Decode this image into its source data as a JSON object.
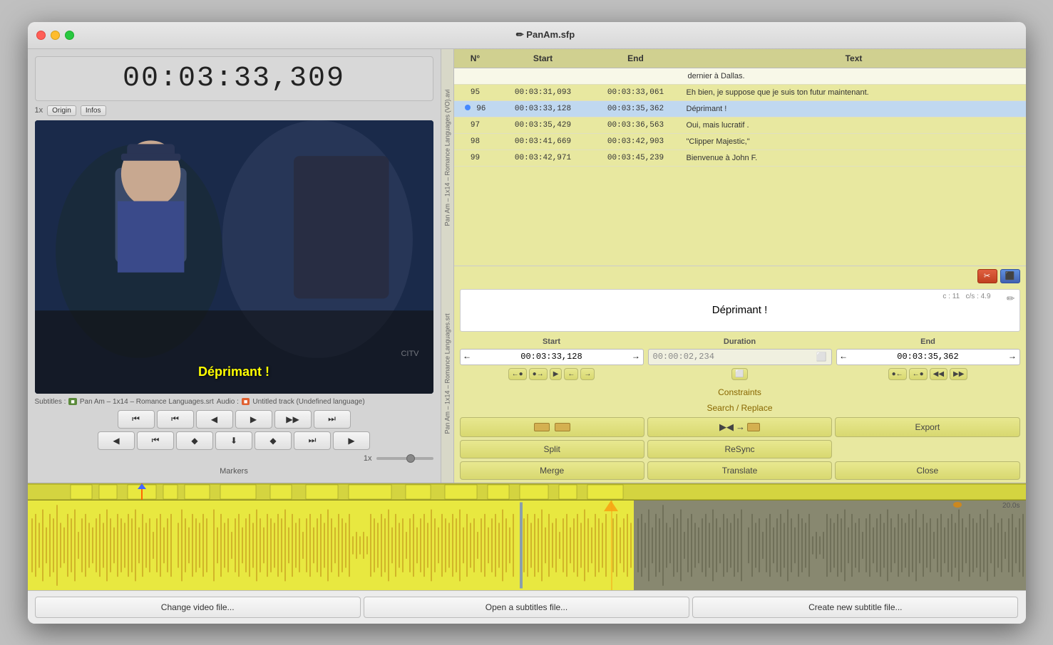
{
  "window": {
    "title": "✏ PanAm.sfp",
    "traffic_lights": [
      "close",
      "minimize",
      "fullscreen"
    ]
  },
  "timecode": "00:03:33,309",
  "video": {
    "subtitle_text": "Déprimant !",
    "watermark": "CITV",
    "magnification": "1x",
    "origin_btn": "Origin",
    "infos_btn": "Infos"
  },
  "subtitles_file": "Pan Am – 1x14 – Romance Languages (VO).avi",
  "subtitle_track": "Pan Am – 1x14 – Romance Languages.srt",
  "audio_track": "Untitled track (Undefined language)",
  "transport": {
    "row1": [
      "⏮",
      "⏮⏮",
      "◀",
      "▶",
      "▶▶",
      "⏭"
    ],
    "row2": [
      "◀",
      "◀◀",
      "◆",
      "⬇",
      "◆",
      "▶▶",
      "▶"
    ]
  },
  "speed": "1x",
  "markers_label": "Markers",
  "table": {
    "headers": [
      "N°",
      "Start",
      "End",
      "Text"
    ],
    "pre_row": {
      "text": "dernier à Dallas."
    },
    "rows": [
      {
        "num": "95",
        "start": "00:03:31,093",
        "end": "00:03:33,061",
        "text": "Eh bien, je suppose que je suis ton futur maintenant.",
        "selected": false
      },
      {
        "num": "96",
        "start": "00:03:33,128",
        "end": "00:03:35,362",
        "text": "Déprimant !",
        "selected": true,
        "current": true
      },
      {
        "num": "97",
        "start": "00:03:35,429",
        "end": "00:03:36,563",
        "text": "Oui, mais lucratif .",
        "selected": false
      },
      {
        "num": "98",
        "start": "00:03:41,669",
        "end": "00:03:42,903",
        "text": "\"Clipper Majestic,\"",
        "selected": false
      },
      {
        "num": "99",
        "start": "00:03:42,971",
        "end": "00:03:45,239",
        "text": "Bienvenue à John F.",
        "selected": false
      }
    ]
  },
  "edit": {
    "text": "Déprimant !",
    "char_count": "c : 11",
    "cps": "c/s : 4.9"
  },
  "timing": {
    "start_label": "Start",
    "duration_label": "Duration",
    "end_label": "End",
    "start_value": "00:03:33,128",
    "duration_value": "00:00:02,234",
    "end_value": "00:03:35,362"
  },
  "actions": {
    "constraints_label": "Constraints",
    "search_replace_label": "Search / Replace",
    "split_label": "Split",
    "resync_label": "ReSync",
    "export_label": "Export",
    "merge_label": "Merge",
    "translate_label": "Translate",
    "close_label": "Close"
  },
  "timeline": {
    "speed_label": "20.0s"
  },
  "bottom": {
    "change_video_label": "Change video file...",
    "open_subtitles_label": "Open a subtitles file...",
    "create_subtitle_label": "Create new subtitle file..."
  }
}
